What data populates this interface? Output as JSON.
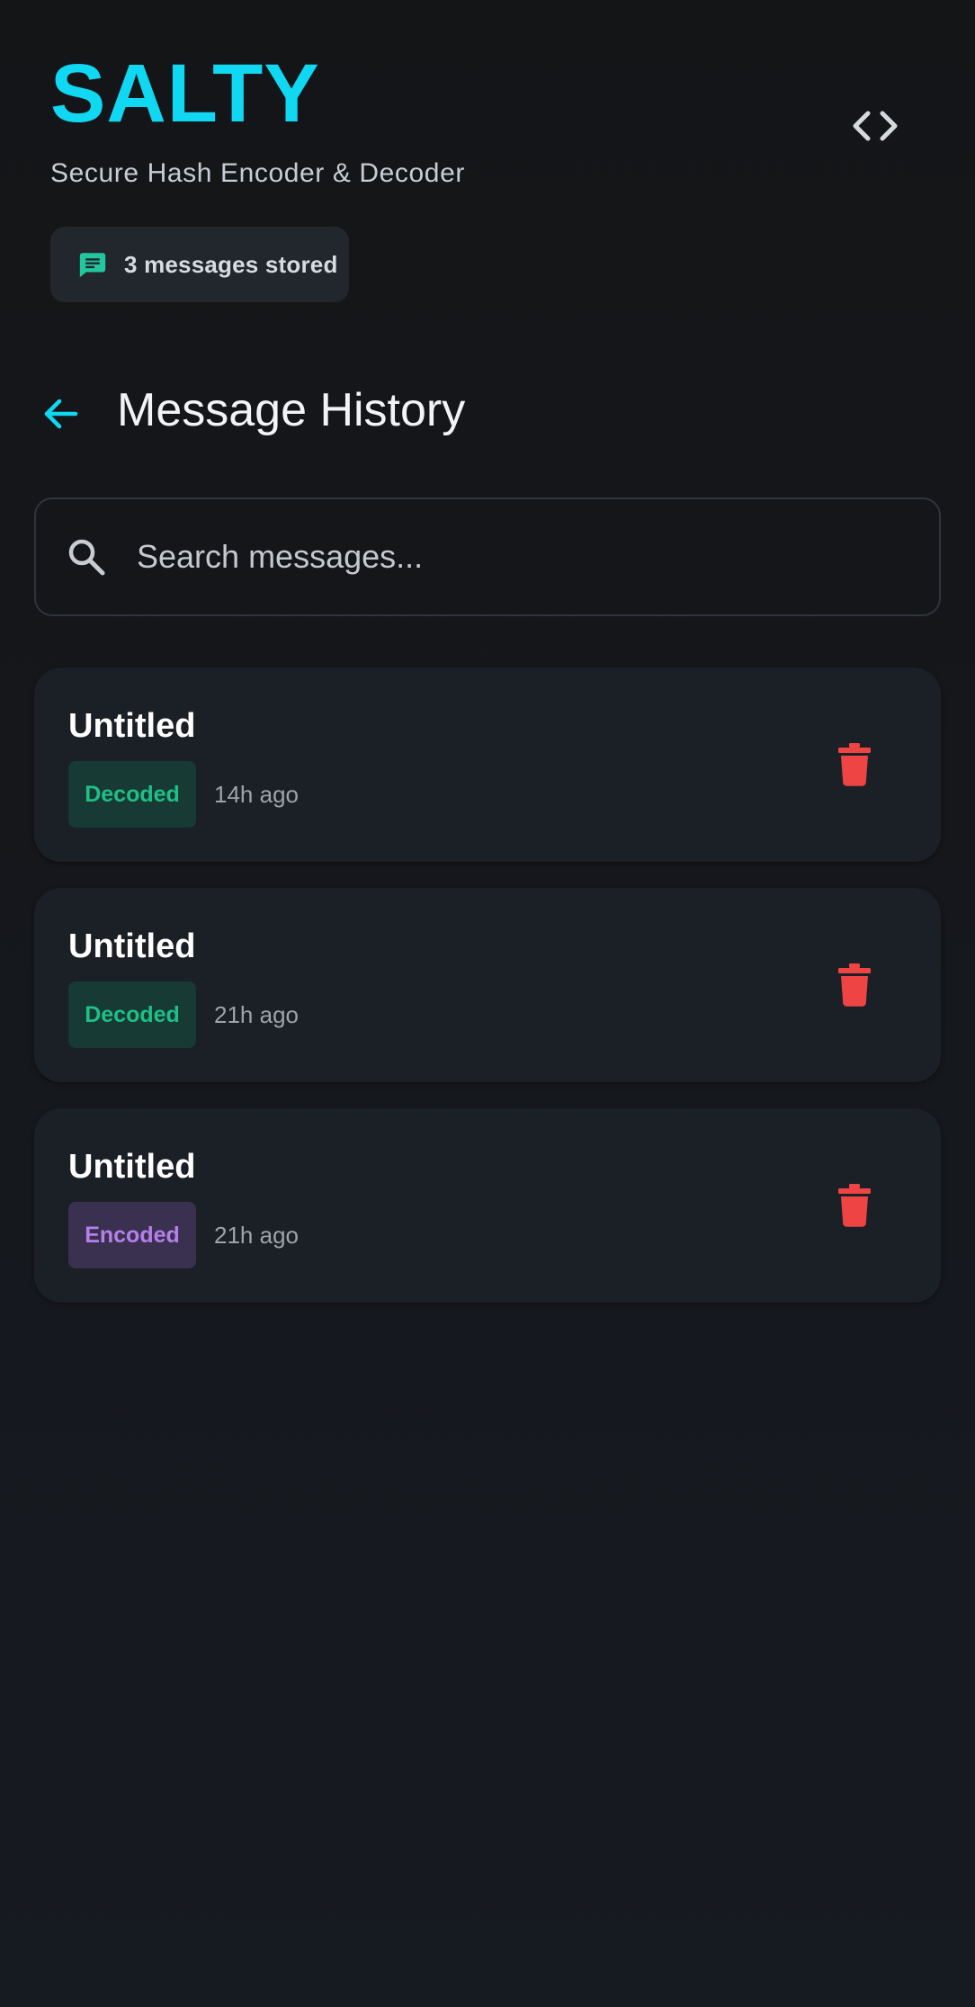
{
  "header": {
    "app_name": "SALTY",
    "subtitle": "Secure Hash Encoder & Decoder",
    "stored_count_label": "3 messages stored"
  },
  "section": {
    "title": "Message History"
  },
  "search": {
    "placeholder": "Search messages...",
    "value": ""
  },
  "messages": [
    {
      "title": "Untitled",
      "status": "Decoded",
      "time": "14h ago"
    },
    {
      "title": "Untitled",
      "status": "Decoded",
      "time": "21h ago"
    },
    {
      "title": "Untitled",
      "status": "Encoded",
      "time": "21h ago"
    }
  ],
  "colors": {
    "accent": "#10d7f2",
    "decoded_text": "#1fbf87",
    "encoded_text": "#b67fea",
    "delete": "#ef4444",
    "background": "#15181d",
    "card": "#1b1f26"
  },
  "icons": {
    "header_action": "code-brackets-icon",
    "chip": "chat-message-icon",
    "back": "arrow-back-icon",
    "search": "search-icon",
    "delete": "trash-icon"
  }
}
